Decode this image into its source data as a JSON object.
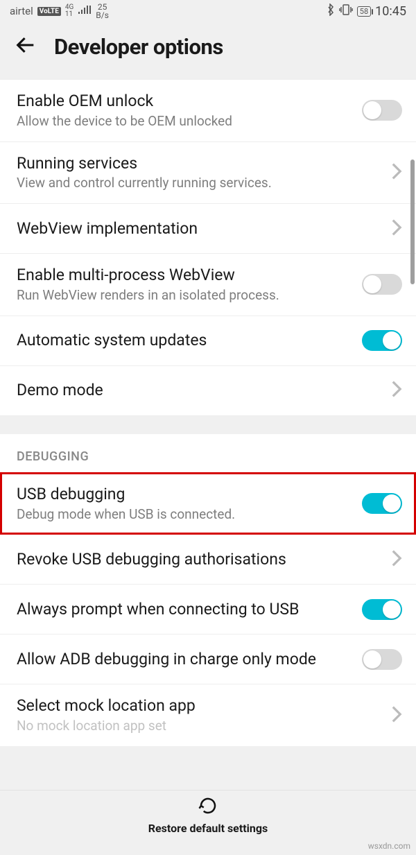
{
  "status": {
    "carrier": "airtel",
    "volte": "VoLTE",
    "net_top": "4G",
    "net_bottom": "11",
    "rate_top": "25",
    "rate_bottom": "B/s",
    "battery": "58",
    "time": "10:45"
  },
  "header": {
    "title": "Developer options"
  },
  "rows": {
    "oem": {
      "title": "Enable OEM unlock",
      "sub": "Allow the device to be OEM unlocked"
    },
    "running": {
      "title": "Running services",
      "sub": "View and control currently running services."
    },
    "webview": {
      "title": "WebView implementation"
    },
    "multiweb": {
      "title": "Enable multi-process WebView",
      "sub": "Run WebView renders in an isolated process."
    },
    "autoupd": {
      "title": "Automatic system updates"
    },
    "demo": {
      "title": "Demo mode"
    },
    "usb": {
      "title": "USB debugging",
      "sub": "Debug mode when USB is connected."
    },
    "revoke": {
      "title": "Revoke USB debugging authorisations"
    },
    "prompt": {
      "title": "Always prompt when connecting to USB"
    },
    "adb": {
      "title": "Allow ADB debugging in charge only mode"
    },
    "mock": {
      "title": "Select mock location app",
      "sub": "No mock location app set"
    }
  },
  "section": {
    "debugging": "DEBUGGING"
  },
  "bottom": {
    "label": "Restore default settings"
  },
  "watermark": "wsxdn.com"
}
